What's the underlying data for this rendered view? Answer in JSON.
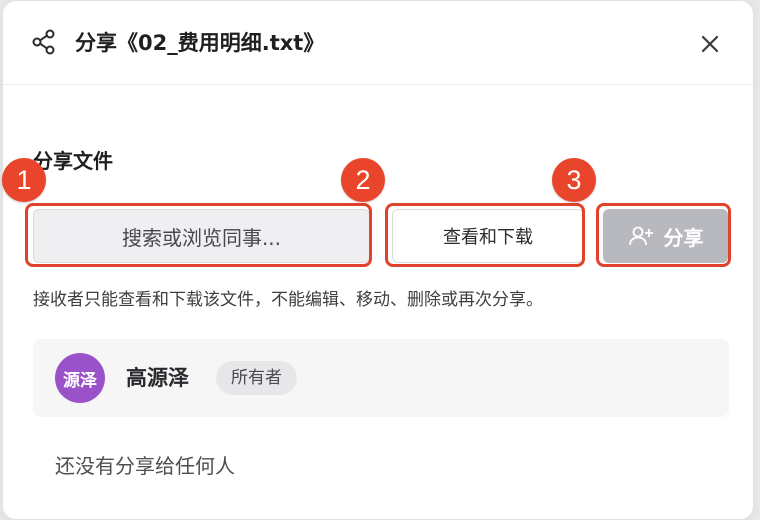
{
  "dialog": {
    "title": "分享《02_费用明细.txt》",
    "icons": {
      "header": "share-icon",
      "close": "close-icon",
      "add_user": "add-user-icon"
    }
  },
  "share": {
    "section_label": "分享文件",
    "search_placeholder": "搜索或浏览同事...",
    "permission_value": "查看和下载",
    "share_button_label": "分享",
    "hint": "接收者只能查看和下载该文件，不能编辑、移动、删除或再次分享。"
  },
  "annotations": [
    "1",
    "2",
    "3"
  ],
  "owner": {
    "avatar_text": "源泽",
    "avatar_color": "#9a52c9",
    "name": "高源泽",
    "badge": "所有者"
  },
  "empty_state": "还没有分享给任何人",
  "colors": {
    "accent": "#e8452c",
    "button_disabled": "#b8b9be"
  }
}
